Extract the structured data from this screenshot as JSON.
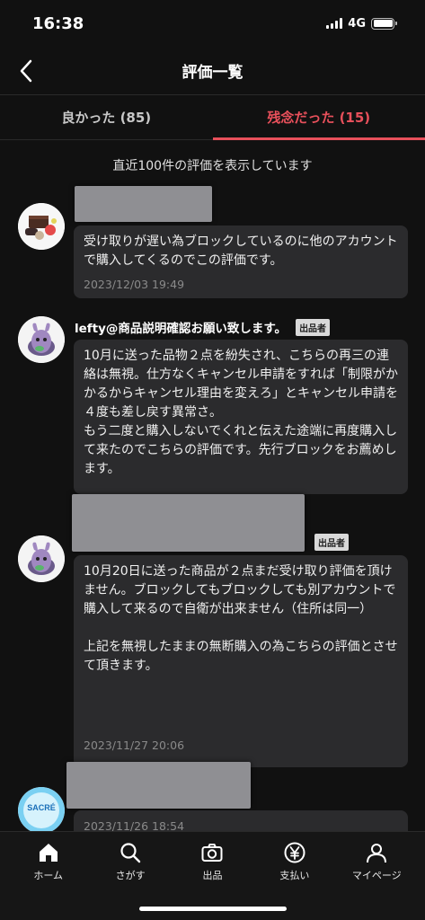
{
  "status_bar": {
    "time": "16:38",
    "network": "4G"
  },
  "header": {
    "title": "評価一覧"
  },
  "tabs": [
    {
      "label": "良かった (85)",
      "active": false
    },
    {
      "label": "残念だった (15)",
      "active": true
    }
  ],
  "notice": "直近100件の評価を表示しています",
  "reviews": [
    {
      "name": "",
      "seller_badge": "",
      "text": "受け取りが遅い為ブロックしているのに他のアカウントで購入してくるのでこの評価です。",
      "date": "2023/12/03 19:49"
    },
    {
      "name": "lefty@商品説明確認お願い致します。",
      "seller_badge": "出品者",
      "text": "10月に送った品物２点を紛失され、こちらの再三の連絡は無視。仕方なくキャンセル申請をすれば「制限がかかるからキャンセル理由を変えろ」とキャンセル申請を４度も差し戻す異常さ。\nもう二度と購入しないでくれと伝えた途端に再度購入して来たのでこちらの評価です。先行ブロックをお薦めします。",
      "date": ""
    },
    {
      "name": "",
      "seller_badge": "出品者",
      "text": "10月20日に送った商品が２点まだ受け取り評価を頂けません。ブロックしてもブロックしても別アカウントで購入して来るので自衛が出来ません（住所は同一）\n\n上記を無視したままの無断購入の為こちらの評価とさせて頂きます。",
      "date": "2023/11/27 20:06"
    },
    {
      "name": "",
      "seller_badge": "",
      "text": "",
      "date": "2023/11/26 18:54",
      "avatar_text": "SACRÉ"
    }
  ],
  "bottom_nav": [
    {
      "label": "ホーム",
      "icon": "home-icon"
    },
    {
      "label": "さがす",
      "icon": "search-icon"
    },
    {
      "label": "出品",
      "icon": "camera-icon"
    },
    {
      "label": "支払い",
      "icon": "yen-icon"
    },
    {
      "label": "マイページ",
      "icon": "person-icon"
    }
  ],
  "colors": {
    "accent": "#e8505b",
    "background": "#111111",
    "bubble": "#2b2b2d"
  }
}
